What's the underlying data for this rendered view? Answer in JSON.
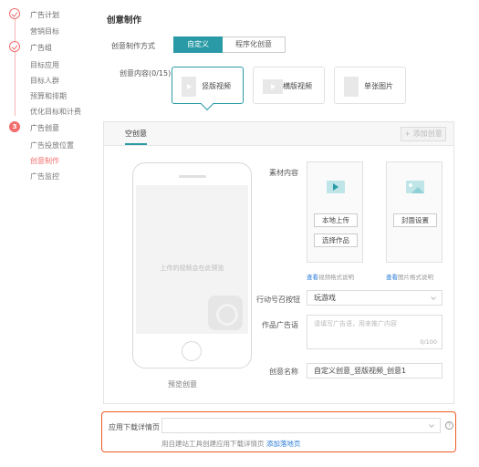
{
  "sidebar": {
    "steps": [
      {
        "title": "广告计划",
        "subs": [
          "营销目标"
        ]
      },
      {
        "title": "广告组",
        "subs": [
          "目标应用",
          "目标人群",
          "预算和排期",
          "优化目标和计费"
        ]
      },
      {
        "title": "广告创意",
        "num": "3",
        "subs": [
          "广告投放位置",
          "创意制作",
          "广告监控"
        ]
      }
    ],
    "active_item": "创意制作"
  },
  "main": {
    "title": "创意制作",
    "mode_label": "创意制作方式",
    "modes": [
      "自定义",
      "程序化创意"
    ],
    "selected_mode": "自定义",
    "content_label": "创意内容(0/15)",
    "content_types": [
      {
        "label": "竖版视频",
        "icon": "vertical-video-icon"
      },
      {
        "label": "横版视频",
        "icon": "horizontal-video-icon"
      },
      {
        "label": "单张图片",
        "icon": "single-image-icon"
      }
    ],
    "selected_type": "竖版视频"
  },
  "panel": {
    "tab": "空创意",
    "add_button": "+ 添加创意",
    "phone_placeholder": "上传的视频会在此预览",
    "preview_label": "预览创意",
    "material_label": "素材内容",
    "upload_local": "本地上传",
    "select_work": "选择作品",
    "cover_setting": "封面设置",
    "video_note_link": "查看",
    "video_note": "视频格式说明",
    "image_note_link": "查看",
    "image_note": "图片格式说明",
    "cta_label": "行动号召按钮",
    "cta_value": "玩游戏",
    "ad_copy_label": "作品广告语",
    "ad_copy_placeholder": "请填写广告语，用来推广内容",
    "ad_copy_counter": "0/100",
    "name_label": "创意名称",
    "name_value": "自定义创意_竖版视频_创意1"
  },
  "bottom": {
    "label": "应用下载详情页",
    "help": "?",
    "note": "用自建站工具创建应用下载详情页",
    "note_link": "添加落地页"
  },
  "colors": {
    "accent": "#2a9ba6",
    "step": "#f26e6e",
    "highlight": "#ef5b25",
    "link": "#2a7bd6"
  }
}
